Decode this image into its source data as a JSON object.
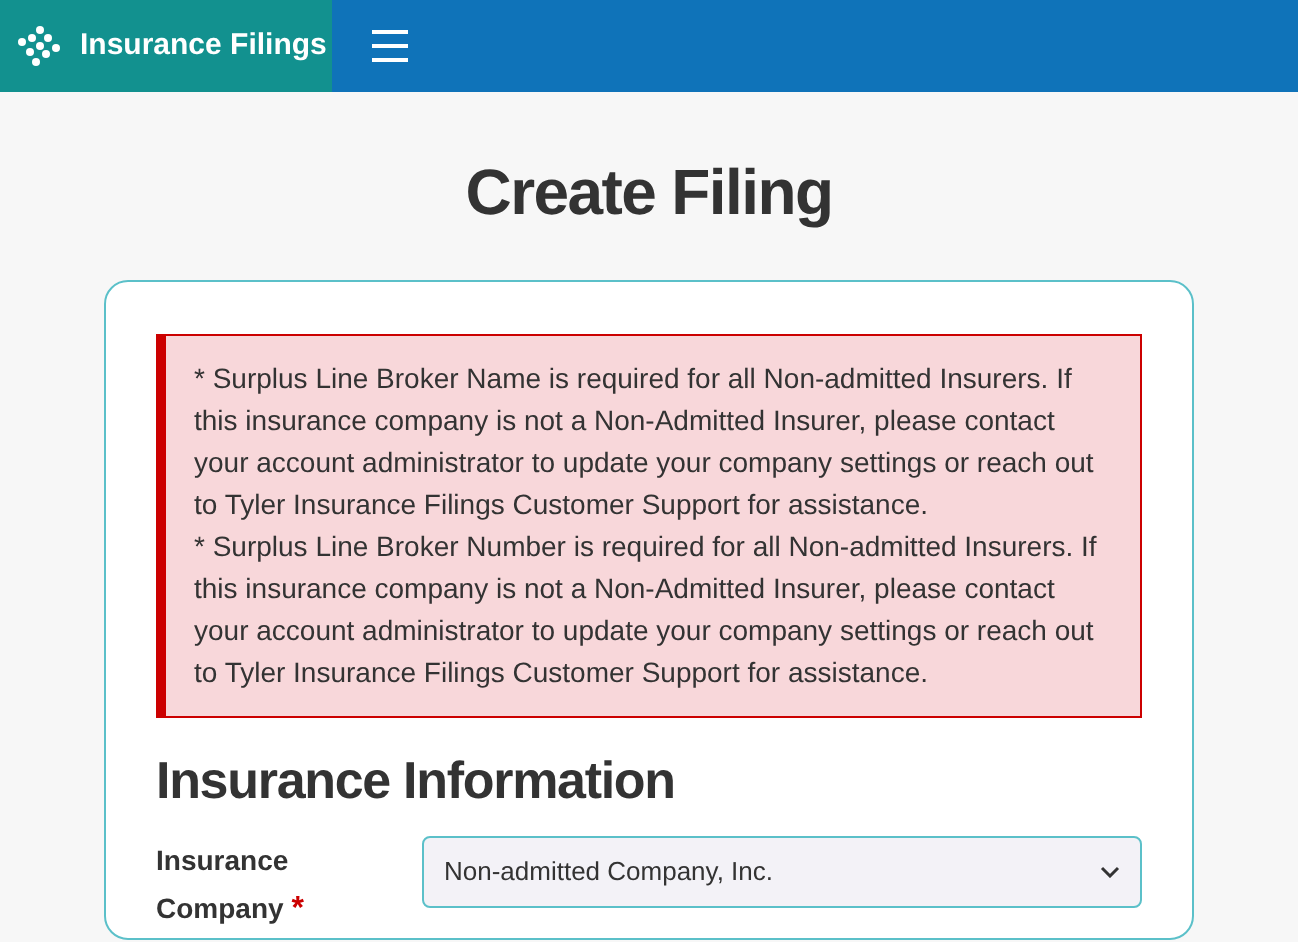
{
  "header": {
    "brand": "Insurance Filings"
  },
  "page_title": "Create Filing",
  "alerts": [
    "* Surplus Line Broker Name is required for all Non-admitted Insurers. If this insurance company is not a Non-Admitted Insurer, please contact your account administrator to update your company settings or reach out to Tyler Insurance Filings Customer Support for assistance.",
    "* Surplus Line Broker Number is required for all Non-admitted Insurers. If this insurance company is not a Non-Admitted Insurer, please contact your account administrator to update your company settings or reach out to Tyler Insurance Filings Customer Support for assistance."
  ],
  "section": {
    "title": "Insurance Information",
    "fields": [
      {
        "label": "Insurance Company",
        "required": true,
        "required_mark": "*",
        "value": "Non-admitted Company, Inc."
      }
    ]
  }
}
